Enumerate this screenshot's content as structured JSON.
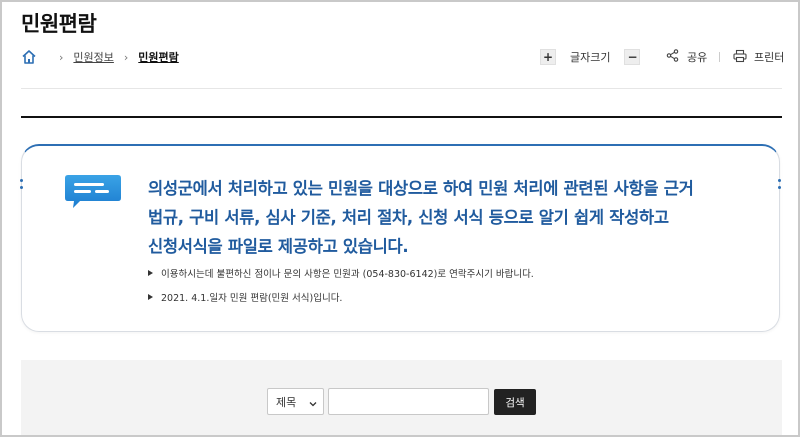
{
  "page": {
    "title": "민원편람"
  },
  "breadcrumb": {
    "home_icon": "home-icon",
    "items": [
      "민원정보",
      "민원편람"
    ]
  },
  "utilities": {
    "font_increase_label": "+",
    "font_size_label": "글자크기",
    "font_decrease_label": "−",
    "share_label": "공유",
    "print_label": "프린터"
  },
  "info": {
    "icon": "chat-bubble-icon",
    "lines": [
      "의성군에서 처리하고 있는 민원을 대상으로 하여 민원 처리에 관련된 사항을 근거",
      "법규, 구비 서류, 심사 기준, 처리 절차, 신청 서식 등으로 알기 쉽게 작성하고",
      "신청서식을 파일로 제공하고 있습니다."
    ],
    "bullets": [
      "이용하시는데 불편하신 점이나 문의 사항은 민원과 (054-830-6142)로 연락주시기 바랍니다.",
      "2021. 4.1.일자 민원 편람(민원 서식)입니다."
    ]
  },
  "search": {
    "select_value": "제목",
    "input_value": "",
    "input_placeholder": "",
    "button_label": "검색"
  },
  "colors": {
    "accent": "#2d6fb4",
    "text_blue": "#205b9e",
    "search_bg": "#f3f3f3",
    "button_dark": "#222222"
  }
}
